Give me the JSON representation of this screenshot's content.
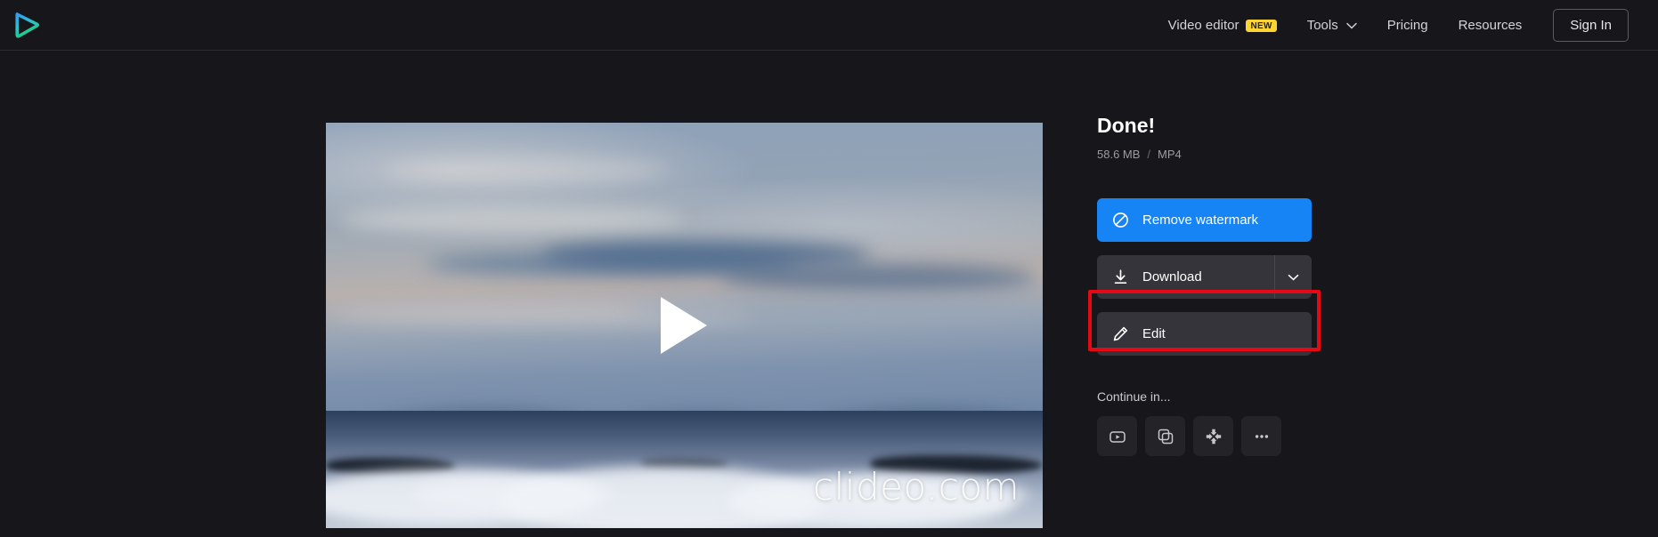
{
  "header": {
    "logo_name": "clideo-play-logo",
    "nav": [
      {
        "label": "Video editor",
        "badge": "NEW",
        "icon": null
      },
      {
        "label": "Tools",
        "badge": null,
        "icon": "chevron-down-icon"
      },
      {
        "label": "Pricing",
        "badge": null,
        "icon": null
      },
      {
        "label": "Resources",
        "badge": null,
        "icon": null
      }
    ],
    "sign_in_label": "Sign In"
  },
  "video": {
    "watermark": "clideo.com",
    "play_icon": "play-icon"
  },
  "panel": {
    "title": "Done!",
    "file_size": "58.6 MB",
    "separator": "/",
    "file_format": "MP4",
    "remove_watermark_label": "Remove watermark",
    "remove_watermark_icon": "no-entry-icon",
    "download_label": "Download",
    "download_icon": "download-icon",
    "download_dropdown_icon": "chevron-down-icon",
    "edit_label": "Edit",
    "edit_icon": "pencil-icon",
    "continue_label": "Continue in...",
    "tools": [
      {
        "name": "video-cutter",
        "icon": "video-play-rect-icon"
      },
      {
        "name": "video-merger",
        "icon": "overlapping-squares-icon"
      },
      {
        "name": "video-compressor",
        "icon": "compress-arrows-icon"
      },
      {
        "name": "more-tools",
        "icon": "ellipsis-icon"
      }
    ]
  },
  "annotation": {
    "highlight_target": "download-button",
    "highlight_color": "#e50914"
  },
  "colors": {
    "background": "#17171b",
    "primary_button": "#1784f5",
    "secondary_button": "#34343a",
    "badge": "#fcd535"
  }
}
